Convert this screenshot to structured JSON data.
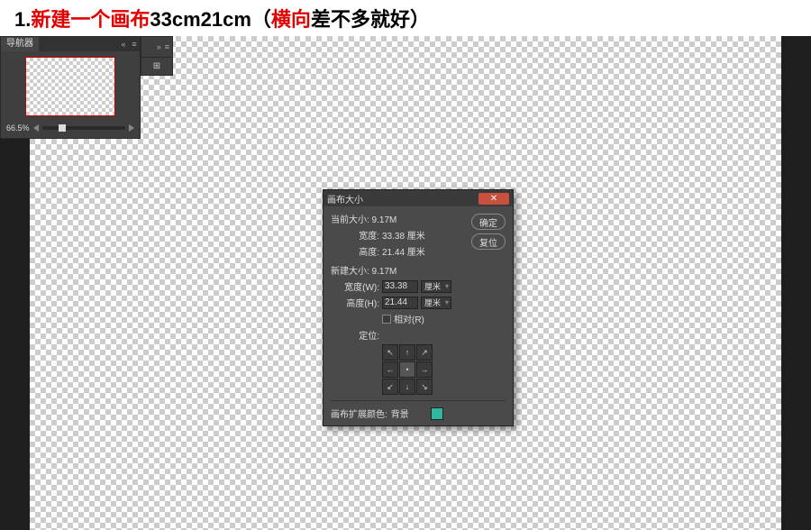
{
  "header": {
    "prefix": "1.",
    "red1": "新建一个画布",
    "black1": "33cm21cm（",
    "red2": "横向",
    "black2": "差不多就好）"
  },
  "navigator": {
    "tab_label": "导航器",
    "collapse_glyph": "«",
    "menu_glyph": "≡",
    "zoom_value": "66.5%"
  },
  "side_panel": {
    "collapse_glyph": "»",
    "menu_glyph": "≡",
    "histogram_glyph": "⊞"
  },
  "dialog": {
    "title": "画布大小",
    "close_glyph": "✕",
    "ok_label": "确定",
    "reset_label": "复位",
    "current": {
      "title": "当前大小: 9.17M",
      "width_label": "宽度:",
      "width_value": "33.38 厘米",
      "height_label": "高度:",
      "height_value": "21.44 厘米"
    },
    "new": {
      "title": "新建大小: 9.17M",
      "width_label": "宽度(W):",
      "width_value": "33.38",
      "height_label": "高度(H):",
      "height_value": "21.44",
      "unit": "厘米",
      "relative_label": "相对(R)",
      "anchor_label": "定位:"
    },
    "anchor_arrows": [
      "↖",
      "↑",
      "↗",
      "←",
      "•",
      "→",
      "↙",
      "↓",
      "↘"
    ],
    "extension": {
      "label": "画布扩展颜色:",
      "value": "背景"
    }
  }
}
